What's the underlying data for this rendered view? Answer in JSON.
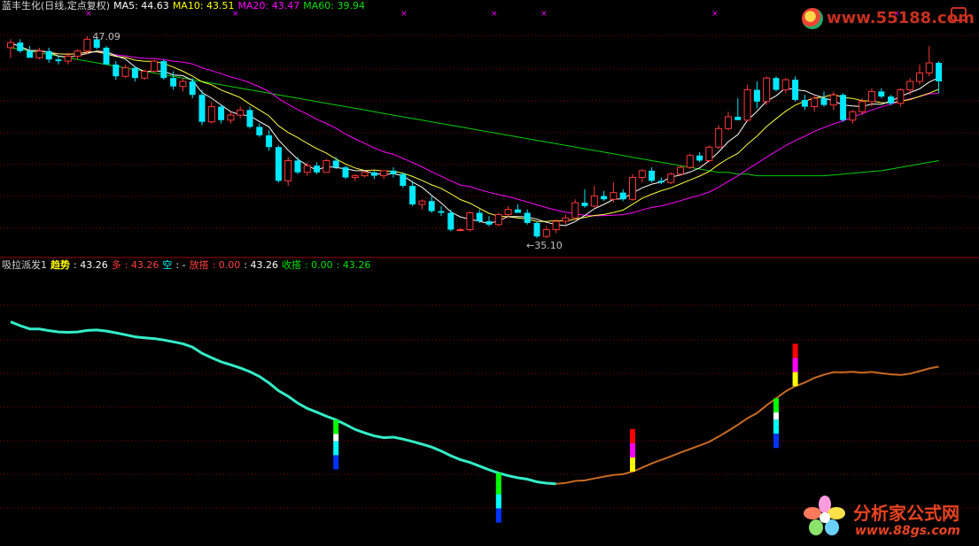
{
  "main_header": [
    {
      "text": "蓝丰生化(日线,定点复权)",
      "color": "#d8d8d8"
    },
    {
      "text": "MA5: 44.63",
      "color": "#ffffff"
    },
    {
      "text": "MA10: 43.51",
      "color": "#ffff00"
    },
    {
      "text": "MA20: 43.47",
      "color": "#ff00ff"
    },
    {
      "text": "MA60: 39.94",
      "color": "#00e000"
    }
  ],
  "indicator_header": [
    {
      "text": "吸拉派发1",
      "color": "#d8d8d8"
    },
    {
      "text": "趋势",
      "color": "#ffff00",
      "bold": true
    },
    {
      "text": ": 43.26",
      "color": "#ffffff"
    },
    {
      "text": "多",
      "color": "#ff4040"
    },
    {
      "text": ": 43.26",
      "color": "#ff4040"
    },
    {
      "text": "空",
      "color": "#00ffff"
    },
    {
      "text": ": -",
      "color": "#ffffff"
    },
    {
      "text": "放搭",
      "color": "#ff4040"
    },
    {
      "text": ": 0.00",
      "color": "#ff4040"
    },
    {
      "text": ": 43.26",
      "color": "#ffffff"
    },
    {
      "text": "收搭",
      "color": "#00e000"
    },
    {
      "text": ": 0.00",
      "color": "#00e000"
    },
    {
      "text": ": 43.26",
      "color": "#00e000"
    }
  ],
  "price_labels": {
    "high": "47.09",
    "low": "←35.10"
  },
  "watermarks": {
    "top": "www.55188.com",
    "bottom_cn": "分析家公式网",
    "bottom_url": "www.88gs.com"
  },
  "colors": {
    "up": "#ff3838",
    "down": "#00e8ff",
    "ma5": "#ffffff",
    "ma10": "#ffff40",
    "ma20": "#ff00ff",
    "ma60": "#00d000",
    "grid": "#8b0000",
    "axis": "#a00000",
    "trend_down": "#33eec8",
    "trend_up": "#c86a20"
  },
  "chart_data": {
    "type": "candlestick",
    "price_range": [
      34.0,
      48.6
    ],
    "candles": [
      [
        46.4,
        46.9,
        45.8,
        46.7
      ],
      [
        46.7,
        46.9,
        46.1,
        46.2
      ],
      [
        46.2,
        46.5,
        45.8,
        45.8
      ],
      [
        45.8,
        46.4,
        45.7,
        46.2
      ],
      [
        46.2,
        46.4,
        45.5,
        45.7
      ],
      [
        45.7,
        45.9,
        45.4,
        45.6
      ],
      [
        45.6,
        46.1,
        45.4,
        45.9
      ],
      [
        45.9,
        46.3,
        45.7,
        46.2
      ],
      [
        46.2,
        47.09,
        46.0,
        46.9
      ],
      [
        46.9,
        47.0,
        46.3,
        46.4
      ],
      [
        46.4,
        46.5,
        45.4,
        45.4
      ],
      [
        45.4,
        45.6,
        44.5,
        44.7
      ],
      [
        44.7,
        45.4,
        44.6,
        45.2
      ],
      [
        45.2,
        45.3,
        44.4,
        44.6
      ],
      [
        44.6,
        45.1,
        44.5,
        45.0
      ],
      [
        45.0,
        45.7,
        44.9,
        45.6
      ],
      [
        45.6,
        45.7,
        44.5,
        44.6
      ],
      [
        44.6,
        45.0,
        43.9,
        44.1
      ],
      [
        44.1,
        44.6,
        43.8,
        44.4
      ],
      [
        44.4,
        44.6,
        43.4,
        43.6
      ],
      [
        43.6,
        43.9,
        41.8,
        42.0
      ],
      [
        42.0,
        43.2,
        41.9,
        42.9
      ],
      [
        42.9,
        43.0,
        41.9,
        42.1
      ],
      [
        42.1,
        42.6,
        41.9,
        42.4
      ],
      [
        42.4,
        42.9,
        42.2,
        42.7
      ],
      [
        42.7,
        42.9,
        41.6,
        41.7
      ],
      [
        41.7,
        41.9,
        41.1,
        41.2
      ],
      [
        41.2,
        41.5,
        40.3,
        40.5
      ],
      [
        40.5,
        40.6,
        38.4,
        38.5
      ],
      [
        38.5,
        39.9,
        38.2,
        39.7
      ],
      [
        39.7,
        39.9,
        38.9,
        39.0
      ],
      [
        39.0,
        39.6,
        38.8,
        39.4
      ],
      [
        39.4,
        39.6,
        38.9,
        39.0
      ],
      [
        39.0,
        39.8,
        39.0,
        39.7
      ],
      [
        39.7,
        39.9,
        39.2,
        39.3
      ],
      [
        39.3,
        39.4,
        38.6,
        38.7
      ],
      [
        38.7,
        38.9,
        38.5,
        38.8
      ],
      [
        38.8,
        39.1,
        38.7,
        39.0
      ],
      [
        39.0,
        39.1,
        38.6,
        38.8
      ],
      [
        38.8,
        39.1,
        38.6,
        39.1
      ],
      [
        39.1,
        39.3,
        38.7,
        38.9
      ],
      [
        38.9,
        39.0,
        38.1,
        38.2
      ],
      [
        38.2,
        38.5,
        37.0,
        37.1
      ],
      [
        37.1,
        37.4,
        36.8,
        37.3
      ],
      [
        37.3,
        37.6,
        36.6,
        36.7
      ],
      [
        36.7,
        37.0,
        36.4,
        36.6
      ],
      [
        36.6,
        36.8,
        35.5,
        35.6
      ],
      [
        35.6,
        35.7,
        35.5,
        35.6
      ],
      [
        35.6,
        36.7,
        35.5,
        36.6
      ],
      [
        36.6,
        36.8,
        36.0,
        36.1
      ],
      [
        36.1,
        36.4,
        35.8,
        35.9
      ],
      [
        35.9,
        36.6,
        35.8,
        36.5
      ],
      [
        36.5,
        37.0,
        36.3,
        36.8
      ],
      [
        36.8,
        37.1,
        36.6,
        36.6
      ],
      [
        36.6,
        36.8,
        35.9,
        36.0
      ],
      [
        36.0,
        36.1,
        35.1,
        35.2
      ],
      [
        35.2,
        35.8,
        35.1,
        35.6
      ],
      [
        35.6,
        36.2,
        35.4,
        36.1
      ],
      [
        36.1,
        36.5,
        35.9,
        36.3
      ],
      [
        36.3,
        37.4,
        36.2,
        37.2
      ],
      [
        37.2,
        38.0,
        36.9,
        37.0
      ],
      [
        37.0,
        38.2,
        36.9,
        37.6
      ],
      [
        37.6,
        37.9,
        37.3,
        37.4
      ],
      [
        37.4,
        38.4,
        37.2,
        37.8
      ],
      [
        37.8,
        38.0,
        37.3,
        37.4
      ],
      [
        37.4,
        38.9,
        37.3,
        38.7
      ],
      [
        38.7,
        39.2,
        38.4,
        39.1
      ],
      [
        39.1,
        39.3,
        38.4,
        38.5
      ],
      [
        38.5,
        38.7,
        38.3,
        38.4
      ],
      [
        38.4,
        39.0,
        38.3,
        38.9
      ],
      [
        38.9,
        39.4,
        38.8,
        39.3
      ],
      [
        39.3,
        40.1,
        39.2,
        40.0
      ],
      [
        40.0,
        40.2,
        39.6,
        39.7
      ],
      [
        39.7,
        40.6,
        39.6,
        40.5
      ],
      [
        40.5,
        41.8,
        40.4,
        41.6
      ],
      [
        41.6,
        42.6,
        41.5,
        42.3
      ],
      [
        42.3,
        43.4,
        42.1,
        42.1
      ],
      [
        42.1,
        44.2,
        42.0,
        43.9
      ],
      [
        43.9,
        44.4,
        42.8,
        43.2
      ],
      [
        43.2,
        44.7,
        43.0,
        44.6
      ],
      [
        44.6,
        44.7,
        43.8,
        43.9
      ],
      [
        43.9,
        44.6,
        43.7,
        44.5
      ],
      [
        44.5,
        44.7,
        43.2,
        43.3
      ],
      [
        43.3,
        43.6,
        42.7,
        42.9
      ],
      [
        42.9,
        43.6,
        42.6,
        43.4
      ],
      [
        43.4,
        43.8,
        42.9,
        43.0
      ],
      [
        43.0,
        43.8,
        42.7,
        43.6
      ],
      [
        43.6,
        43.7,
        42.0,
        42.1
      ],
      [
        42.1,
        42.7,
        41.9,
        42.6
      ],
      [
        42.6,
        43.4,
        42.4,
        43.2
      ],
      [
        43.2,
        44.0,
        42.9,
        43.8
      ],
      [
        43.8,
        44.0,
        43.4,
        43.5
      ],
      [
        43.5,
        43.6,
        43.0,
        43.1
      ],
      [
        43.1,
        44.0,
        42.9,
        43.9
      ],
      [
        43.9,
        44.6,
        43.6,
        44.4
      ],
      [
        44.4,
        45.4,
        44.2,
        44.9
      ],
      [
        44.9,
        46.5,
        44.7,
        45.5
      ],
      [
        45.5,
        45.6,
        43.7,
        44.4
      ]
    ],
    "ma60": [
      46.4,
      46.3,
      46.2,
      46.1,
      46.0,
      45.9,
      45.8,
      45.7,
      45.6,
      45.5,
      45.4,
      45.3,
      45.2,
      45.1,
      45.0,
      44.9,
      44.8,
      44.7,
      44.6,
      44.5,
      44.4,
      44.3,
      44.2,
      44.1,
      44.0,
      43.9,
      43.8,
      43.7,
      43.6,
      43.5,
      43.4,
      43.3,
      43.2,
      43.1,
      43.0,
      42.9,
      42.8,
      42.7,
      42.6,
      42.5,
      42.4,
      42.3,
      42.2,
      42.1,
      42.0,
      41.9,
      41.8,
      41.7,
      41.6,
      41.5,
      41.4,
      41.3,
      41.2,
      41.1,
      41.0,
      40.9,
      40.8,
      40.7,
      40.6,
      40.5,
      40.4,
      40.3,
      40.2,
      40.1,
      40.0,
      39.9,
      39.8,
      39.7,
      39.6,
      39.5,
      39.4,
      39.3,
      39.2,
      39.1,
      39.0,
      39.0,
      38.9,
      38.9,
      38.8,
      38.8,
      38.8,
      38.8,
      38.8,
      38.8,
      38.8,
      38.8,
      38.85,
      38.9,
      38.95,
      39.0,
      39.05,
      39.1,
      39.2,
      39.3,
      39.4,
      39.5,
      39.6,
      39.7
    ],
    "indicator": {
      "range": [
        34.0,
        48.6
      ],
      "trend_switch_index": 57,
      "towers": [
        {
          "index": 34,
          "top": "green",
          "segments": [
            "#00ff00",
            "#00ff00",
            "#ffffff",
            "#00ffff",
            "#00ffff",
            "#0033ff",
            "#0033ff"
          ],
          "dir": "down"
        },
        {
          "index": 51,
          "top": "green",
          "segments": [
            "#00ff00",
            "#00ff00",
            "#00ff00",
            "#00ffff",
            "#00ffff",
            "#0033ff",
            "#0033ff"
          ],
          "dir": "down"
        },
        {
          "index": 65,
          "top": "yellow",
          "segments": [
            "#ffff00",
            "#ffff00",
            "#ff00ff",
            "#ff00ff",
            "#ff0000",
            "#ff0000"
          ],
          "dir": "up"
        },
        {
          "index": 80,
          "top": "green",
          "segments": [
            "#00ff00",
            "#00ff00",
            "#ffffff",
            "#00ffff",
            "#00ffff",
            "#0033ff",
            "#0033ff"
          ],
          "dir": "down"
        },
        {
          "index": 82,
          "top": "yellow",
          "segments": [
            "#ffff00",
            "#ffff00",
            "#ff00ff",
            "#ff00ff",
            "#ff0000",
            "#ff0000"
          ],
          "dir": "up"
        }
      ]
    }
  }
}
